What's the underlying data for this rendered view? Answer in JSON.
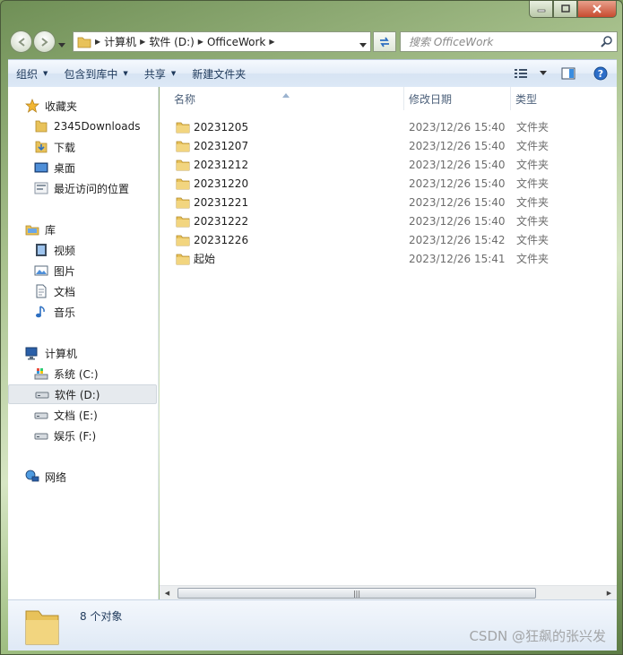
{
  "window": {
    "caption_buttons": [
      "minimize",
      "maximize",
      "close"
    ]
  },
  "address_bar": {
    "crumbs": [
      "计算机",
      "软件 (D:)",
      "OfficeWork"
    ]
  },
  "search": {
    "placeholder": "搜索 OfficeWork"
  },
  "toolbar": {
    "organize": "组织",
    "include_in_library": "包含到库中",
    "share": "共享",
    "new_folder": "新建文件夹"
  },
  "navpane": {
    "favorites": {
      "label": "收藏夹",
      "items": [
        "2345Downloads",
        "下载",
        "桌面",
        "最近访问的位置"
      ]
    },
    "libraries": {
      "label": "库",
      "items": [
        "视频",
        "图片",
        "文档",
        "音乐"
      ]
    },
    "computer": {
      "label": "计算机",
      "items": [
        "系统 (C:)",
        "软件 (D:)",
        "文档 (E:)",
        "娱乐 (F:)"
      ],
      "selected": "软件 (D:)"
    },
    "network": {
      "label": "网络"
    }
  },
  "columns": {
    "name": "名称",
    "date": "修改日期",
    "type": "类型"
  },
  "files": [
    {
      "name": "20231205",
      "date": "2023/12/26 15:40",
      "type": "文件夹"
    },
    {
      "name": "20231207",
      "date": "2023/12/26 15:40",
      "type": "文件夹"
    },
    {
      "name": "20231212",
      "date": "2023/12/26 15:40",
      "type": "文件夹"
    },
    {
      "name": "20231220",
      "date": "2023/12/26 15:40",
      "type": "文件夹"
    },
    {
      "name": "20231221",
      "date": "2023/12/26 15:40",
      "type": "文件夹"
    },
    {
      "name": "20231222",
      "date": "2023/12/26 15:40",
      "type": "文件夹"
    },
    {
      "name": "20231226",
      "date": "2023/12/26 15:42",
      "type": "文件夹"
    },
    {
      "name": "起始",
      "date": "2023/12/26 15:41",
      "type": "文件夹"
    }
  ],
  "details": {
    "count": "8 个对象"
  },
  "watermark": "CSDN @狂飙的张兴发",
  "colors": {
    "toolbar_text": "#1e395b",
    "header_text": "#4c607a",
    "folder": "#e8c25a"
  }
}
